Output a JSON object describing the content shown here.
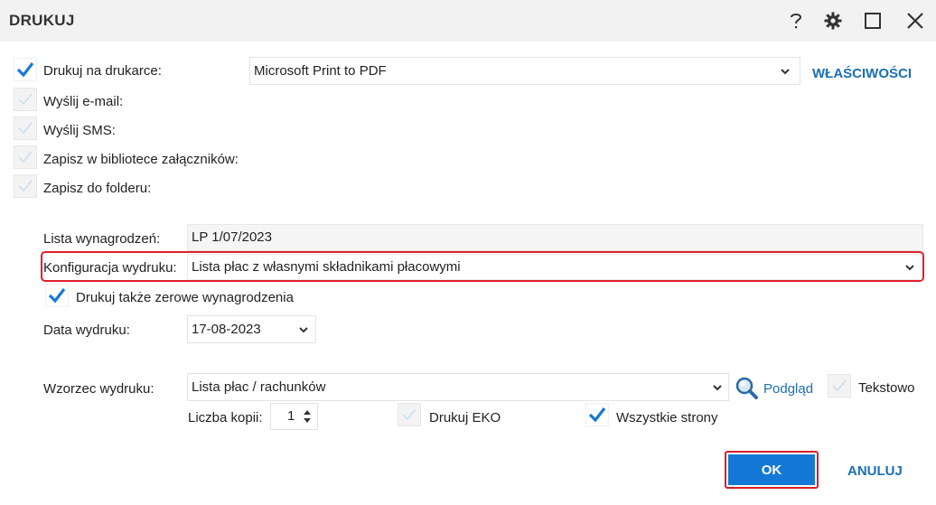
{
  "window": {
    "title": "DRUKUJ",
    "icons": [
      "help-icon",
      "gear-icon",
      "maximize-icon",
      "close-icon"
    ]
  },
  "output_options": [
    {
      "label": "Drukuj na drukarce:",
      "checked": true
    },
    {
      "label": "Wyślij e-mail:",
      "checked": false
    },
    {
      "label": "Wyślij SMS:",
      "checked": false
    },
    {
      "label": "Zapisz w bibliotece załączników:",
      "checked": false
    },
    {
      "label": "Zapisz do folderu:",
      "checked": false
    }
  ],
  "printer": {
    "selected": "Microsoft Print to PDF",
    "properties_label": "WŁAŚCIWOŚCI"
  },
  "payroll": {
    "list_label": "Lista wynagrodzeń:",
    "list_value": "LP 1/07/2023",
    "config_label": "Konfiguracja wydruku:",
    "config_value": "Lista płac z własnymi składnikami płacowymi",
    "zero_label": "Drukuj także zerowe wynagrodzenia",
    "zero_checked": true,
    "date_label": "Data wydruku:",
    "date_value": "17-08-2023"
  },
  "template": {
    "label": "Wzorzec wydruku:",
    "value": "Lista płac / rachunków",
    "preview_label": "Podgląd",
    "text_label": "Tekstowo",
    "text_checked": false,
    "copies_label": "Liczba kopii:",
    "copies_value": "1",
    "eko_label": "Drukuj EKO",
    "eko_checked": false,
    "all_pages_label": "Wszystkie strony",
    "all_pages_checked": true
  },
  "buttons": {
    "ok": "OK",
    "cancel": "ANULUJ"
  },
  "colors": {
    "accent": "#1479d6",
    "link": "#1a6fb5",
    "highlight": "#e0202a"
  }
}
